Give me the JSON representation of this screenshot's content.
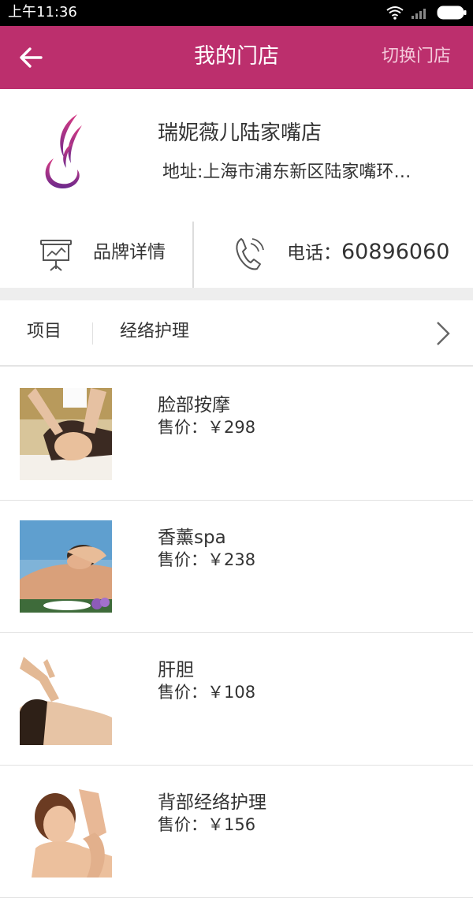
{
  "status_bar": {
    "time": "上午11:36"
  },
  "header": {
    "title": "我的门店",
    "switch_label": "切换门店"
  },
  "store": {
    "name": "瑞妮薇儿陆家嘴店",
    "address": "地址:上海市浦东新区陆家嘴环…",
    "brand_label": "品牌详情",
    "phone_label": "电话：",
    "phone_number": "60896060"
  },
  "category": {
    "label": "项目",
    "value": "经络护理"
  },
  "items": [
    {
      "name": "脸部按摩",
      "price": "售价：￥298"
    },
    {
      "name": "香薰spa",
      "price": "售价：￥238"
    },
    {
      "name": "肝胆",
      "price": "售价：￥108"
    },
    {
      "name": "背部经络护理",
      "price": "售价：￥156"
    }
  ],
  "colors": {
    "brand": "#bc2f6d",
    "switch_text": "#f4c9da"
  }
}
